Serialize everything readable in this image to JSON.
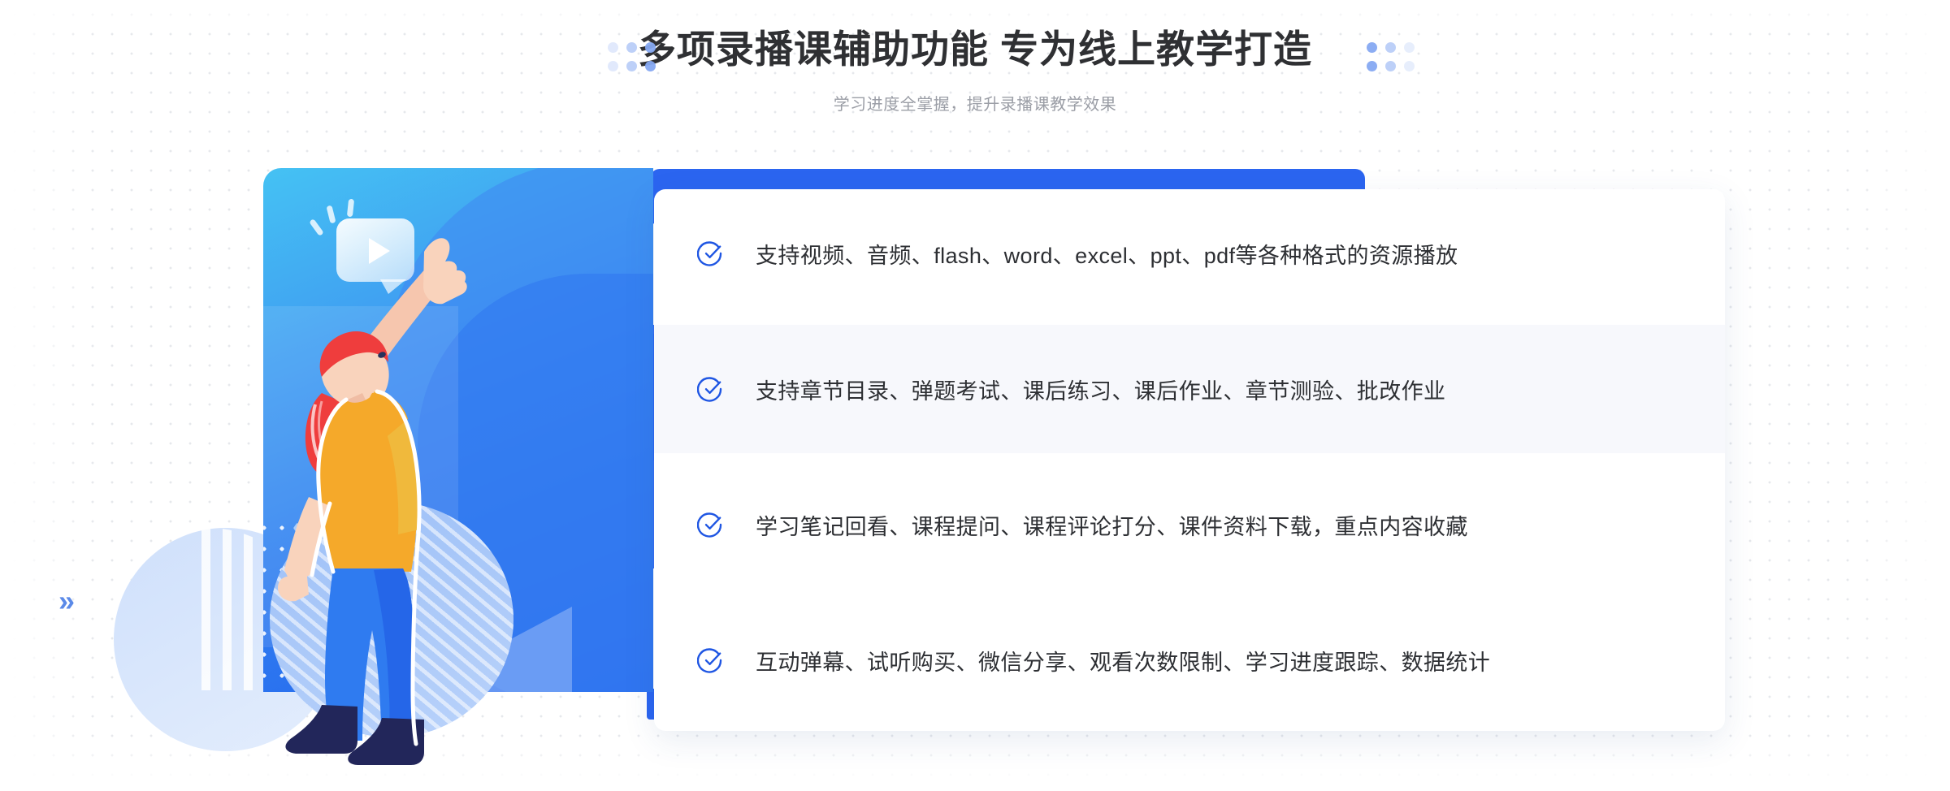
{
  "header": {
    "title": "多项录播课辅助功能 专为线上教学打造",
    "subtitle": "学习进度全掌握，提升录播课教学效果"
  },
  "decorations": {
    "left_chevron": "»",
    "illustration_chevron": "«",
    "dot_cluster_left": "dots-3x2",
    "dot_cluster_right": "dots-3x2"
  },
  "illustration": {
    "alt": "woman pointing at video play bubble",
    "play_icon": "play-icon",
    "gradient_start": "#45c2f3",
    "gradient_end": "#2463ee"
  },
  "colors": {
    "accent_blue": "#2b65f0",
    "check_blue": "#1f56e3",
    "title_gray": "#2f3033",
    "subtitle_gray": "#9b9ea6",
    "row_highlight": "#f7f8fc"
  },
  "features": [
    {
      "icon": "check-circle-icon",
      "text": "支持视频、音频、flash、word、excel、ppt、pdf等各种格式的资源播放",
      "highlighted": false
    },
    {
      "icon": "check-circle-icon",
      "text": "支持章节目录、弹题考试、课后练习、课后作业、章节测验、批改作业",
      "highlighted": true
    },
    {
      "icon": "check-circle-icon",
      "text": "学习笔记回看、课程提问、课程评论打分、课件资料下载，重点内容收藏",
      "highlighted": false
    },
    {
      "icon": "check-circle-icon",
      "text": "互动弹幕、试听购买、微信分享、观看次数限制、学习进度跟踪、数据统计",
      "highlighted": false
    }
  ]
}
